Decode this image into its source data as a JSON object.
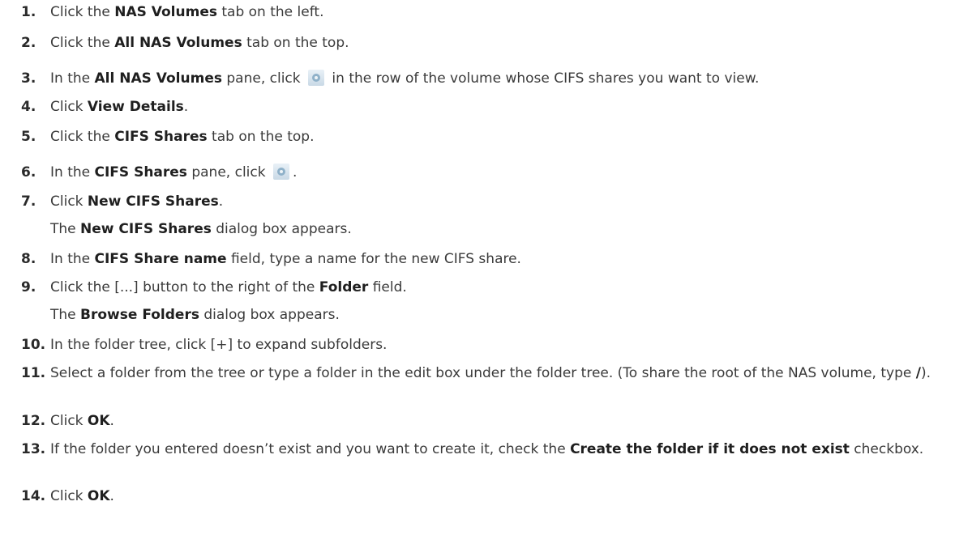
{
  "steps": [
    {
      "num": "1.",
      "parts": [
        {
          "t": "Click the "
        },
        {
          "b": "NAS Volumes"
        },
        {
          "t": " tab on the left."
        }
      ]
    },
    {
      "num": "2.",
      "parts": [
        {
          "t": "Click the "
        },
        {
          "b": "All NAS Volumes"
        },
        {
          "t": " tab on the top."
        }
      ]
    },
    {
      "num": "3.",
      "parts": [
        {
          "t": "In the "
        },
        {
          "b": "All NAS Volumes"
        },
        {
          "t": " pane, click "
        },
        {
          "icon": "gear-icon"
        },
        {
          "t": " in the row of the volume whose CIFS shares you want to view."
        }
      ]
    },
    {
      "num": "4.",
      "parts": [
        {
          "t": "Click "
        },
        {
          "b": "View Details"
        },
        {
          "t": "."
        }
      ]
    },
    {
      "num": "5.",
      "parts": [
        {
          "t": "Click the "
        },
        {
          "b": "CIFS Shares"
        },
        {
          "t": " tab on the top."
        }
      ]
    },
    {
      "num": "6.",
      "parts": [
        {
          "t": "In the "
        },
        {
          "b": "CIFS Shares"
        },
        {
          "t": " pane, click "
        },
        {
          "icon": "gear-icon"
        },
        {
          "t": "."
        }
      ]
    },
    {
      "num": "7.",
      "parts": [
        {
          "t": "Click "
        },
        {
          "b": "New CIFS Shares"
        },
        {
          "t": "."
        }
      ],
      "sub": [
        {
          "t": "The "
        },
        {
          "b": "New CIFS Shares"
        },
        {
          "t": " dialog box appears."
        }
      ]
    },
    {
      "num": "8.",
      "parts": [
        {
          "t": "In the "
        },
        {
          "b": "CIFS Share name"
        },
        {
          "t": " field, type a name for the new CIFS share."
        }
      ]
    },
    {
      "num": "9.",
      "parts": [
        {
          "t": "Click the [...] button to the right of the "
        },
        {
          "b": "Folder"
        },
        {
          "t": " field."
        }
      ],
      "sub": [
        {
          "t": "The "
        },
        {
          "b": "Browse Folders"
        },
        {
          "t": " dialog box appears."
        }
      ]
    },
    {
      "num": "10.",
      "parts": [
        {
          "t": "In the folder tree, click [+] to expand subfolders."
        }
      ]
    },
    {
      "num": "11.",
      "parts": [
        {
          "t": "Select a folder from the tree or type a folder in the edit box under the folder tree. (To share the root of the NAS volume, type "
        },
        {
          "b": "/"
        },
        {
          "t": ")."
        }
      ]
    },
    {
      "num": "12.",
      "parts": [
        {
          "t": "Click "
        },
        {
          "b": "OK"
        },
        {
          "t": "."
        }
      ]
    },
    {
      "num": "13.",
      "parts": [
        {
          "t": "If the folder you entered doesn’t exist and you want to create it, check the "
        },
        {
          "b": "Create the folder if it does not exist"
        },
        {
          "t": " checkbox."
        }
      ]
    },
    {
      "num": "14.",
      "parts": [
        {
          "t": "Click "
        },
        {
          "b": "OK"
        },
        {
          "t": "."
        }
      ]
    }
  ]
}
